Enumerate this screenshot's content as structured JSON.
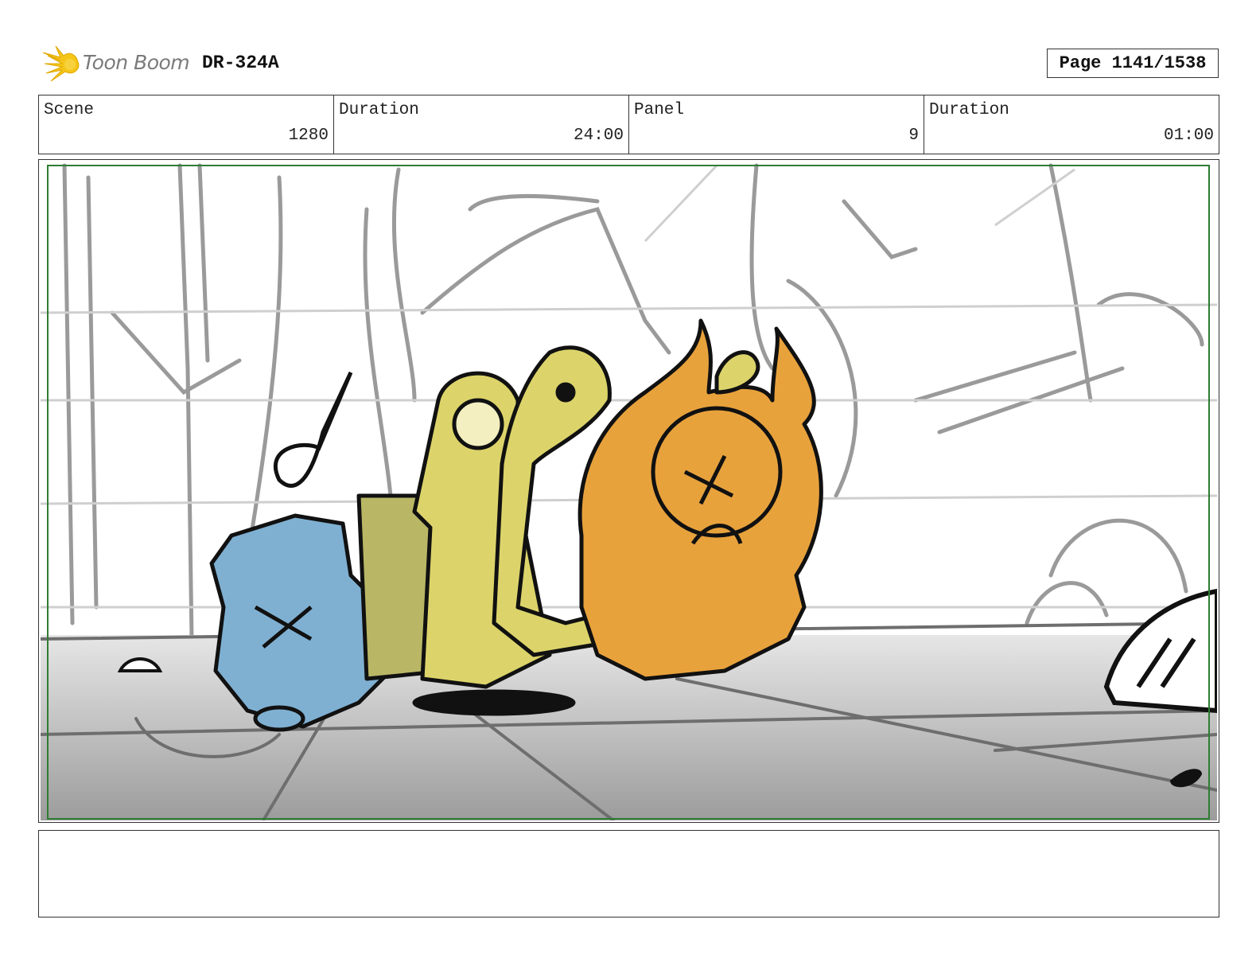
{
  "header": {
    "logo_text": "Toon Boom",
    "doc_id": "DR-324A",
    "page_label": "Page 1141/1538"
  },
  "info": [
    {
      "label": "Scene",
      "value": "1280"
    },
    {
      "label": "Duration",
      "value": "24:00"
    },
    {
      "label": "Panel",
      "value": "9"
    },
    {
      "label": "Duration",
      "value": "01:00"
    }
  ],
  "panel": {
    "characters": [
      "blue-character",
      "yellow-character",
      "yellow-creature",
      "orange-creature"
    ]
  },
  "notes": "",
  "colors": {
    "safe_frame": "#2e7d32",
    "blue_character": "#7fb0d2",
    "yellow_character": "#dcd46a",
    "orange_creature": "#e8a23c",
    "logo_accent": "#f5c518"
  }
}
